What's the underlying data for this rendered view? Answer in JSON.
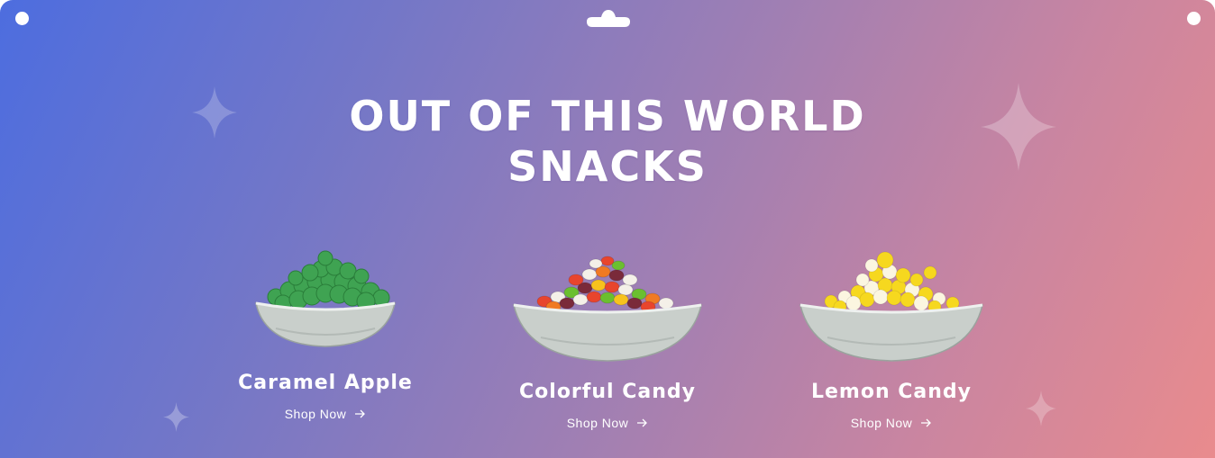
{
  "headline": {
    "line1": "OUT OF THIS WORLD",
    "line2": "SNACKS"
  },
  "products": [
    {
      "name": "Caramel Apple",
      "cta": "Shop Now",
      "icon": "arrow-right-icon"
    },
    {
      "name": "Colorful Candy",
      "cta": "Shop Now",
      "icon": "arrow-right-icon"
    },
    {
      "name": "Lemon Candy",
      "cta": "Shop Now",
      "icon": "arrow-right-icon"
    }
  ],
  "colors": {
    "gradient_start": "#4d6ddf",
    "gradient_end": "#e98b8d",
    "text": "#ffffff"
  }
}
